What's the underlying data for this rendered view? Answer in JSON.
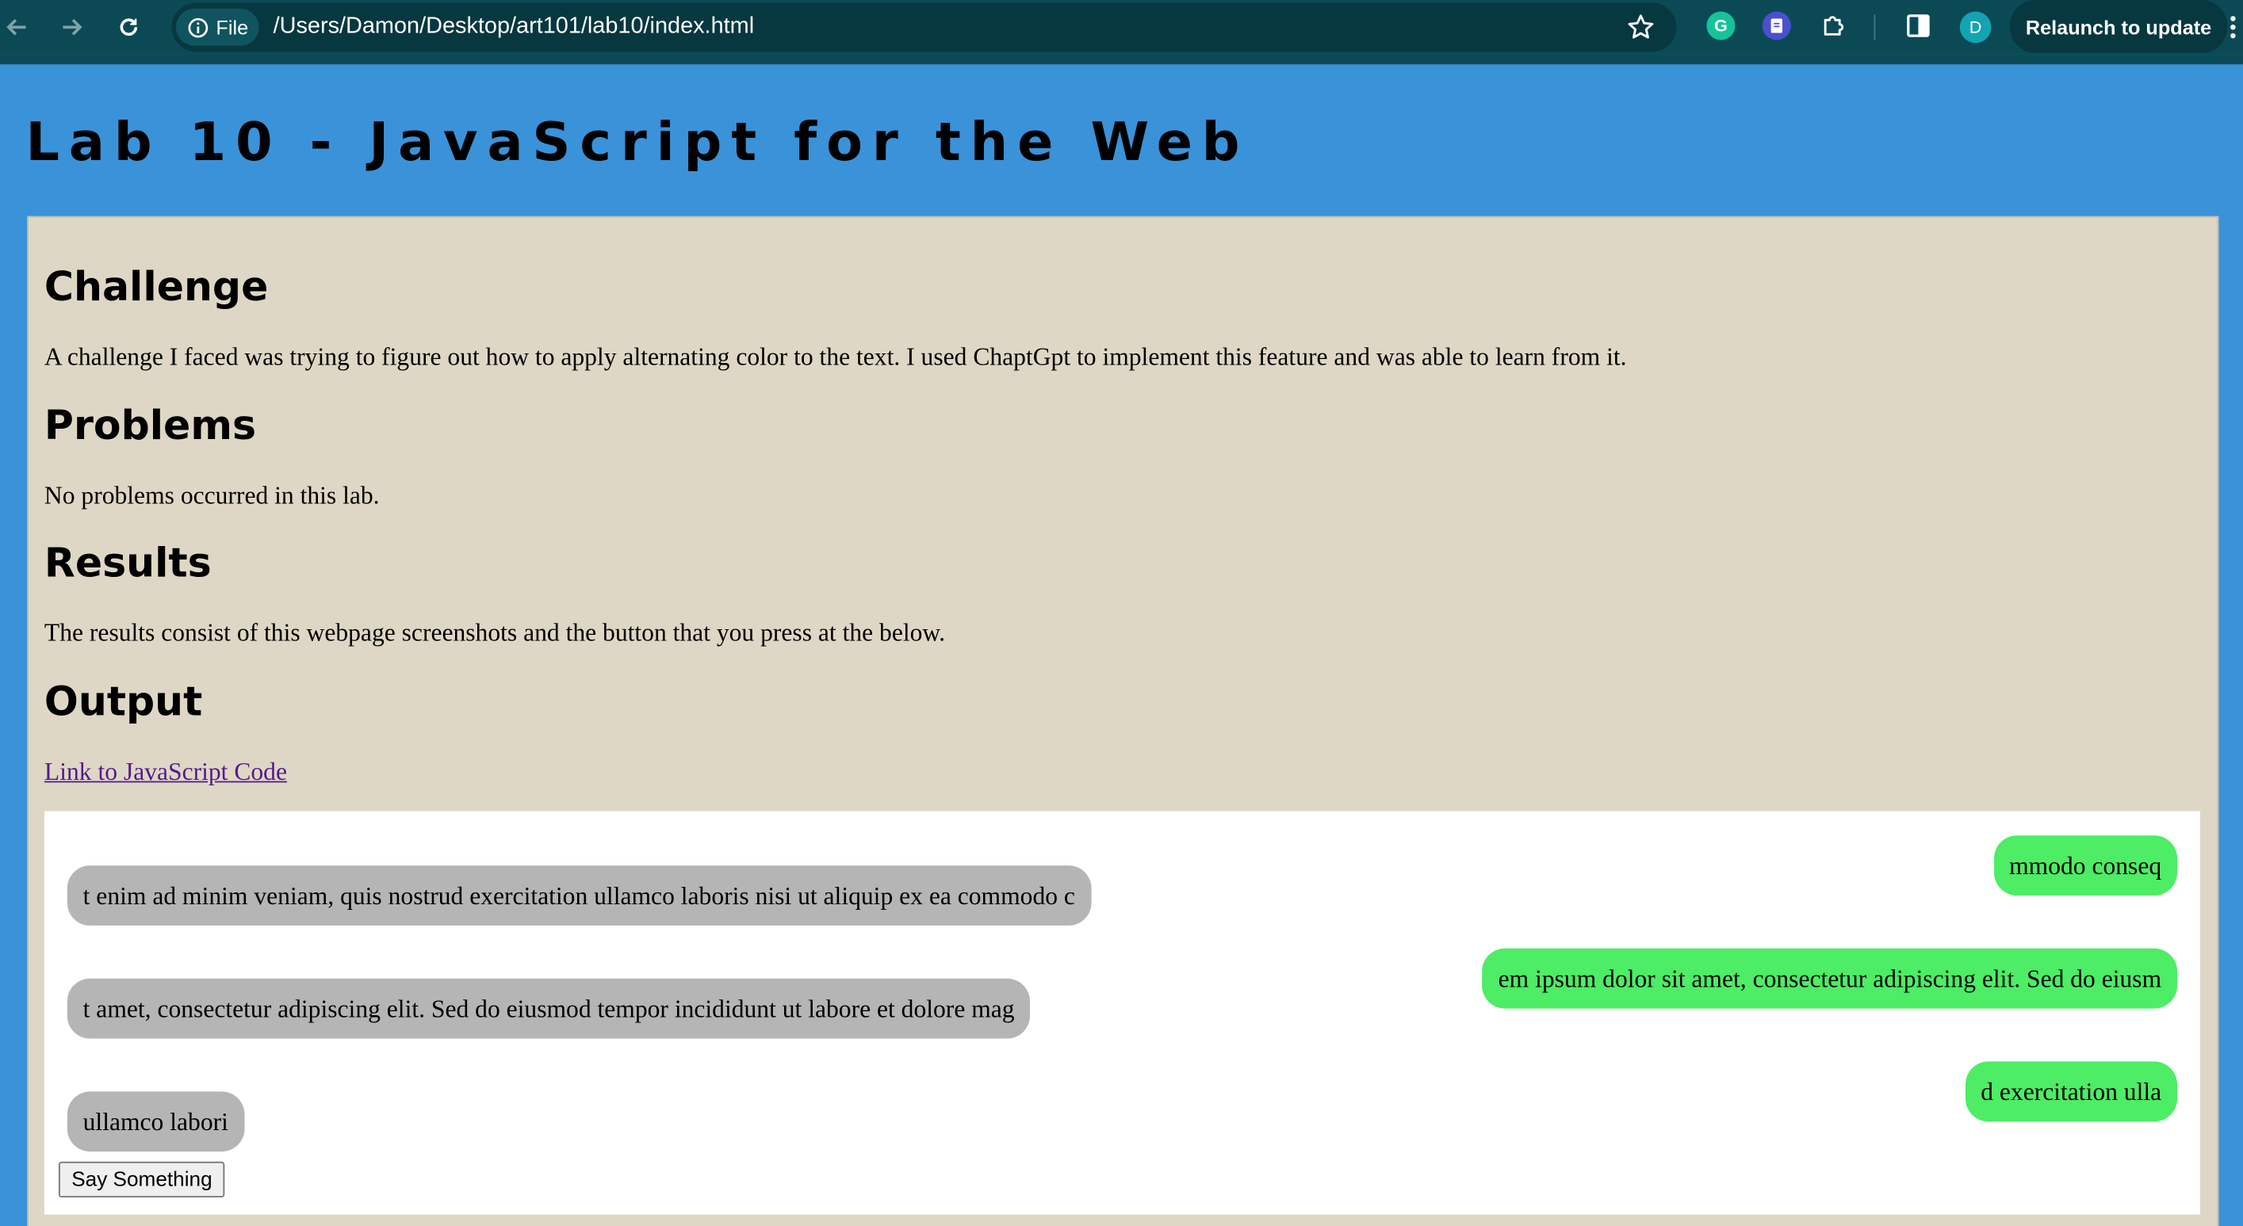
{
  "browser": {
    "url_scheme_label": "File",
    "url": "/Users/Damon/Desktop/art101/lab10/index.html",
    "profile_initial": "D",
    "relaunch_label": "Relaunch to update",
    "grammarly_letter": "G",
    "icons": [
      "back-icon",
      "forward-icon",
      "reload-icon",
      "info-icon",
      "star-icon",
      "grammarly-icon",
      "docs-extension-icon",
      "extensions-puzzle-icon",
      "side-panel-icon",
      "kebab-menu-icon"
    ]
  },
  "page": {
    "title": "Lab 10 - JavaScript for the Web",
    "sections": {
      "challenge": {
        "heading": "Challenge",
        "text": "A challenge I faced was trying to figure out how to apply alternating color to the text. I used ChaptGpt to implement this feature and was able to learn from it."
      },
      "problems": {
        "heading": "Problems",
        "text": "No problems occurred in this lab."
      },
      "results": {
        "heading": "Results",
        "text": "The results consist of this webpage screenshots and the button that you press at the below."
      },
      "output": {
        "heading": "Output",
        "link_text": "Link to JavaScript Code"
      }
    },
    "chat": {
      "messages": [
        {
          "side": "right",
          "text": "mmodo conseq"
        },
        {
          "side": "left",
          "text": "t enim ad minim veniam, quis nostrud exercitation ullamco laboris nisi ut aliquip ex ea commodo c"
        },
        {
          "side": "right",
          "text": "em ipsum dolor sit amet, consectetur adipiscing elit. Sed do eiusm"
        },
        {
          "side": "left",
          "text": "t amet, consectetur adipiscing elit. Sed do eiusmod tempor incididunt ut labore et dolore mag"
        },
        {
          "side": "right",
          "text": "d exercitation ulla"
        },
        {
          "side": "left",
          "text": "ullamco labori"
        }
      ],
      "button_label": "Say Something"
    }
  },
  "colors": {
    "page_background": "#3a92d9",
    "content_background": "#ded7c5",
    "chrome_background": "#0b4a55",
    "bubble_left": "#b5b5b5",
    "bubble_right": "#4ded65",
    "link": "#551a8b"
  }
}
